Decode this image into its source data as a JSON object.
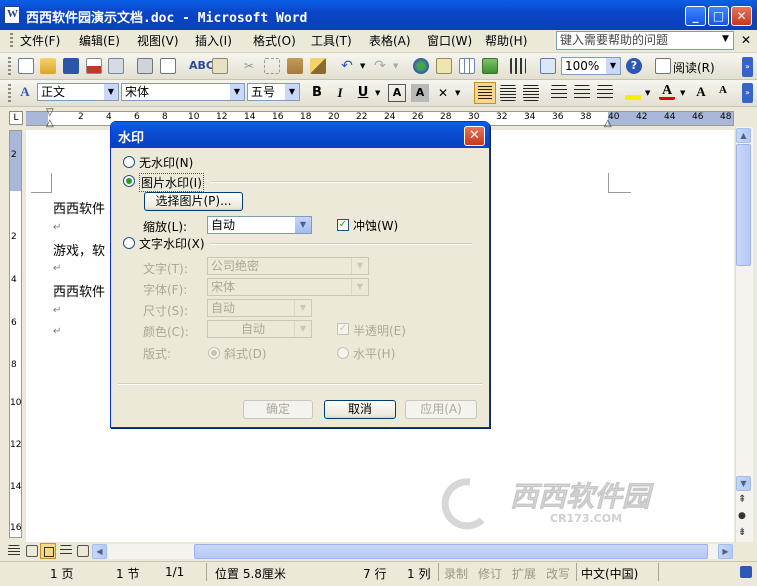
{
  "window": {
    "title": "西西软件园演示文档.doc - Microsoft Word"
  },
  "menu": [
    "文件(F)",
    "编辑(E)",
    "视图(V)",
    "插入(I)",
    "格式(O)",
    "工具(T)",
    "表格(A)",
    "窗口(W)",
    "帮助(H)"
  ],
  "help_box": {
    "placeholder": "键入需要帮助的问题"
  },
  "toolbar": {
    "zoom": "100%",
    "read_label": "阅读(R)"
  },
  "format_bar": {
    "style": "正文",
    "font": "宋体",
    "size": "五号"
  },
  "ruler": {
    "numbers": [
      "2",
      "4",
      "6",
      "8",
      "10",
      "12",
      "14",
      "16",
      "18",
      "20",
      "22",
      "24",
      "26",
      "28",
      "30",
      "32",
      "34",
      "36",
      "38",
      "40",
      "42",
      "44",
      "46",
      "48"
    ]
  },
  "vruler": {
    "numbers": [
      "2",
      "2",
      "4",
      "6",
      "8",
      "10",
      "12",
      "14",
      "16"
    ]
  },
  "document": {
    "paragraphs": [
      "西西软件",
      "游戏，软",
      "西西软件"
    ],
    "para_mark": "↵"
  },
  "dialog": {
    "title": "水印",
    "no_watermark": "无水印(N)",
    "picture_watermark": "图片水印(I)",
    "select_picture": "选择图片(P)...",
    "scale_label": "缩放(L):",
    "scale_value": "自动",
    "washout_label": "冲蚀(W)",
    "text_watermark": "文字水印(X)",
    "text_label": "文字(T):",
    "text_value": "公司绝密",
    "font_label": "字体(F):",
    "font_value": "宋体",
    "size_label": "尺寸(S):",
    "size_value": "自动",
    "color_label": "颜色(C):",
    "color_value": "自动",
    "semitransparent": "半透明(E)",
    "layout_label": "版式:",
    "diagonal": "斜式(D)",
    "horizontal": "水平(H)",
    "ok": "确定",
    "cancel": "取消",
    "apply": "应用(A)"
  },
  "status": {
    "page": "1 页",
    "section": "1 节",
    "page_of": "1/1",
    "position": "位置 5.8厘米",
    "line": "7 行",
    "column": "1 列",
    "rec": "录制",
    "trk": "修订",
    "ext": "扩展",
    "ovr": "改写",
    "language": "中文(中国)"
  },
  "watermark_logo": {
    "text": "西西软件园",
    "sub": "CR173.COM"
  }
}
